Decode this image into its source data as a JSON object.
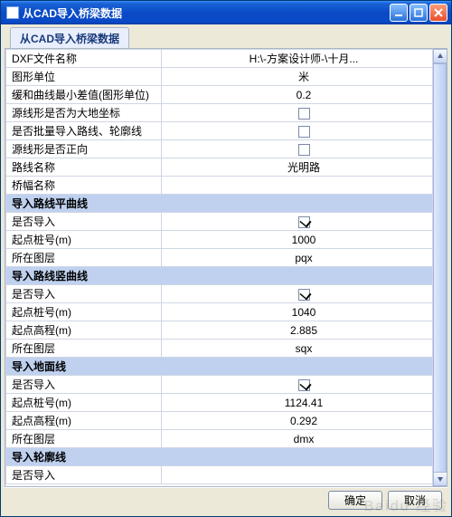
{
  "window": {
    "title": "从CAD导入桥梁数据"
  },
  "tab": {
    "label": "从CAD导入桥梁数据"
  },
  "rows": {
    "dxf_name_label": "DXF文件名称",
    "dxf_name_value": "H:\\-方案设计师-\\十月...",
    "shape_unit_label": "图形单位",
    "shape_unit_value": "米",
    "curve_min_label": "缓和曲线最小差值(图形单位)",
    "curve_min_value": "0.2",
    "src_earth_label": "源线形是否为大地坐标",
    "batch_import_label": "是否批量导入路线、轮廓线",
    "src_forward_label": "源线形是否正向",
    "route_name_label": "路线名称",
    "route_name_value": "光明路",
    "bridge_name_label": "桥幅名称",
    "sec_hcurve": "导入路线平曲线",
    "h_import_label": "是否导入",
    "h_start_label": "起点桩号(m)",
    "h_start_value": "1000",
    "h_layer_label": "所在图层",
    "h_layer_value": "pqx",
    "sec_vcurve": "导入路线竖曲线",
    "v_import_label": "是否导入",
    "v_start_label": "起点桩号(m)",
    "v_start_value": "1040",
    "v_elev_label": "起点高程(m)",
    "v_elev_value": "2.885",
    "v_layer_label": "所在图层",
    "v_layer_value": "sqx",
    "sec_ground": "导入地面线",
    "g_import_label": "是否导入",
    "g_start_label": "起点桩号(m)",
    "g_start_value": "1124.41",
    "g_elev_label": "起点高程(m)",
    "g_elev_value": "0.292",
    "g_layer_label": "所在图层",
    "g_layer_value": "dmx",
    "sec_outline": "导入轮廓线",
    "o_import_label": "是否导入"
  },
  "buttons": {
    "ok": "确定",
    "cancel": "取消"
  },
  "checks": {
    "src_earth": false,
    "batch_import": false,
    "src_forward": false,
    "h_import": true,
    "v_import": true,
    "g_import": true
  }
}
